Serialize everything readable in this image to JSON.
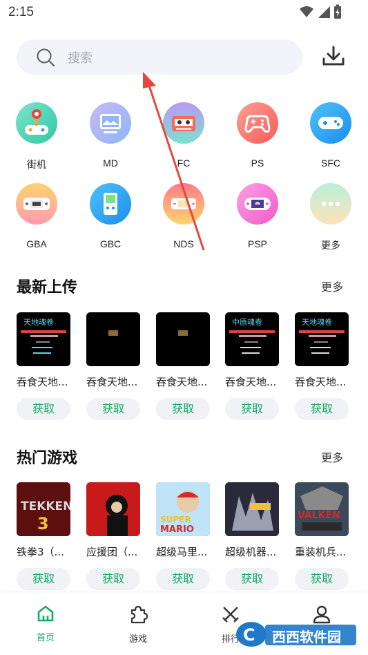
{
  "status_bar": {
    "time": "2:15"
  },
  "search": {
    "placeholder": "搜索"
  },
  "platforms": [
    {
      "label": "街机",
      "icon": "arcade-joystick-icon"
    },
    {
      "label": "MD",
      "icon": "md-monitor-icon"
    },
    {
      "label": "FC",
      "icon": "fc-cartridge-icon"
    },
    {
      "label": "PS",
      "icon": "ps-gamepad-icon"
    },
    {
      "label": "SFC",
      "icon": "sfc-gamepad-icon"
    },
    {
      "label": "GBA",
      "icon": "gba-handheld-icon"
    },
    {
      "label": "GBC",
      "icon": "gbc-handheld-icon"
    },
    {
      "label": "NDS",
      "icon": "nds-handheld-icon"
    },
    {
      "label": "PSP",
      "icon": "psp-handheld-icon"
    },
    {
      "label": "更多",
      "icon": "more-dots-icon"
    }
  ],
  "latest": {
    "title": "最新上传",
    "more": "更多",
    "items": [
      {
        "title": "吞食天地...",
        "button": "获取"
      },
      {
        "title": "吞食天地...",
        "button": "获取"
      },
      {
        "title": "吞食天地...",
        "button": "获取"
      },
      {
        "title": "吞食天地...",
        "button": "获取"
      },
      {
        "title": "吞食天地...",
        "button": "获取"
      }
    ]
  },
  "popular": {
    "title": "热门游戏",
    "more": "更多",
    "items": [
      {
        "title": "铁拳3（...",
        "button": "获取"
      },
      {
        "title": "应援团（...",
        "button": "获取"
      },
      {
        "title": "超级马里...",
        "button": "获取"
      },
      {
        "title": "超级机器...",
        "button": "获取"
      },
      {
        "title": "重装机兵...",
        "button": "获取"
      }
    ]
  },
  "bottom_nav": [
    {
      "label": "首页",
      "active": true
    },
    {
      "label": "游戏",
      "active": false
    },
    {
      "label": "排行",
      "active": false
    },
    {
      "label": "",
      "active": false
    }
  ],
  "watermark": {
    "text": "西西软件园"
  },
  "colors": {
    "accent": "#17a864",
    "search_bg": "#f2f4fa",
    "button_bg": "#f0f2f5",
    "arrow": "#e8453c"
  }
}
